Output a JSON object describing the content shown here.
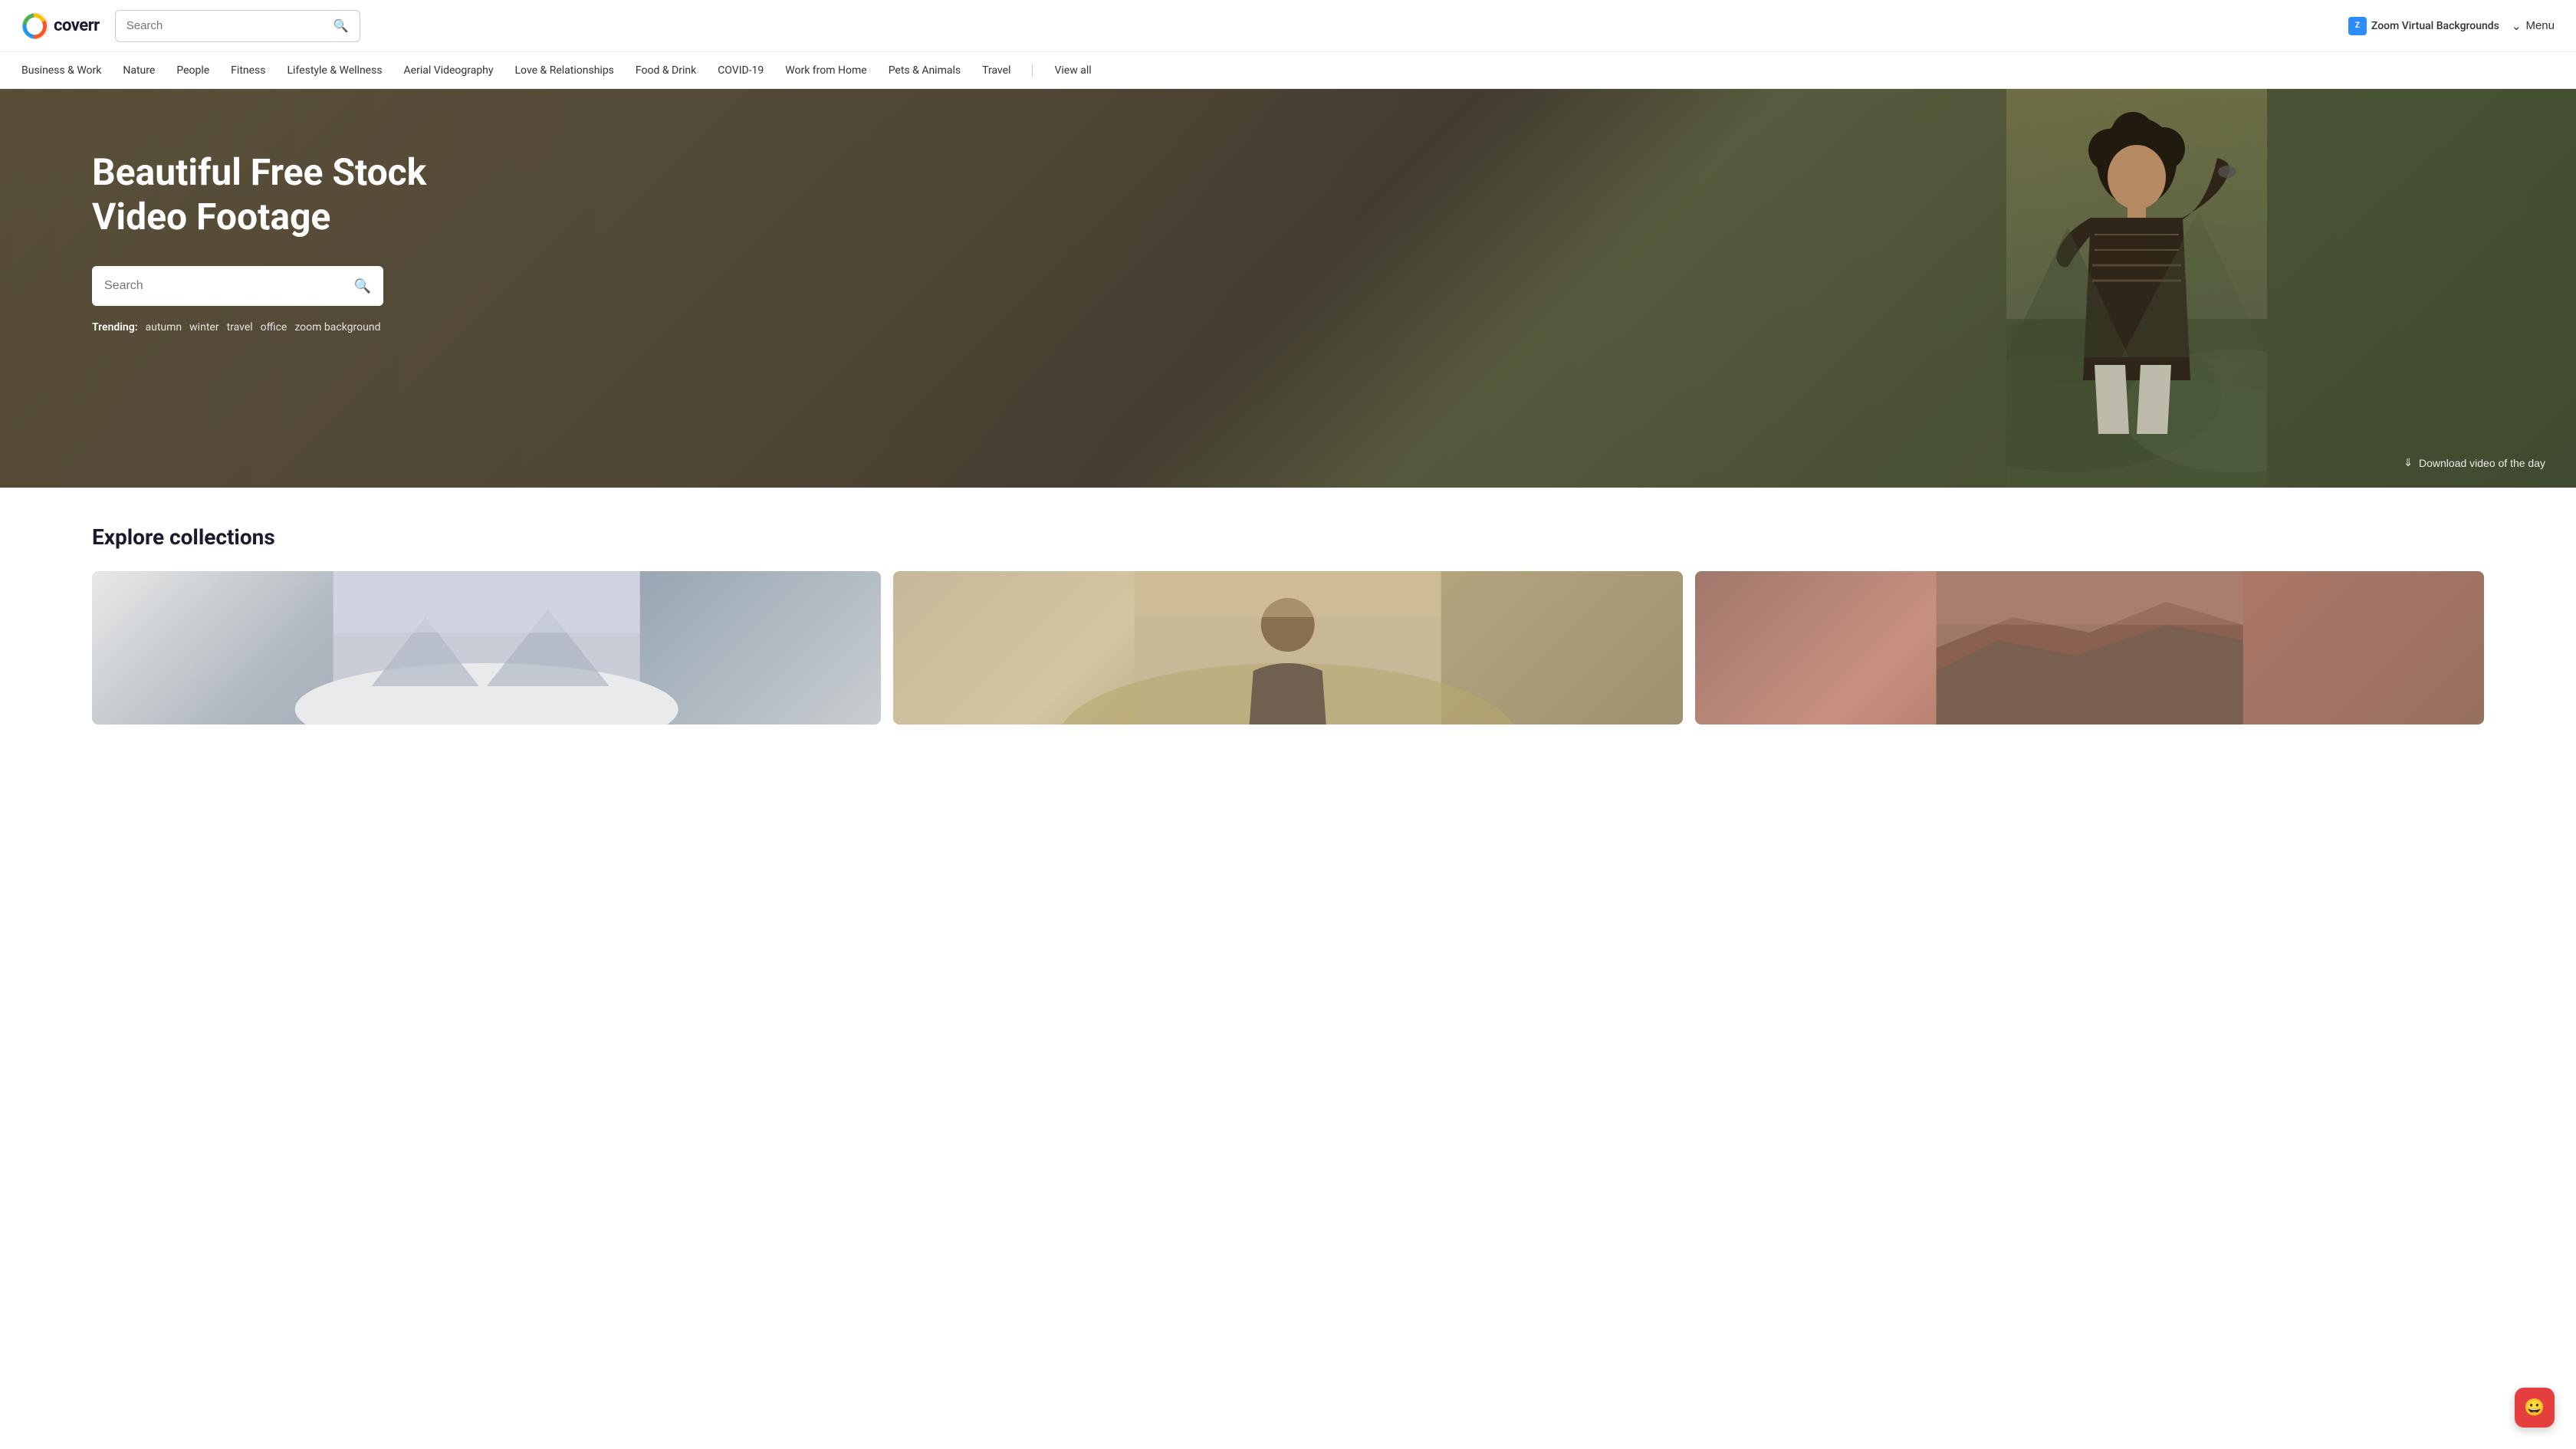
{
  "header": {
    "logo_text": "coverr",
    "search_placeholder": "Search",
    "zoom_label": "Zoom Virtual Backgrounds",
    "menu_label": "Menu"
  },
  "nav": {
    "items": [
      {
        "label": "Business & Work",
        "href": "#"
      },
      {
        "label": "Nature",
        "href": "#"
      },
      {
        "label": "People",
        "href": "#"
      },
      {
        "label": "Fitness",
        "href": "#"
      },
      {
        "label": "Lifestyle & Wellness",
        "href": "#"
      },
      {
        "label": "Aerial Videography",
        "href": "#"
      },
      {
        "label": "Love & Relationships",
        "href": "#"
      },
      {
        "label": "Food & Drink",
        "href": "#"
      },
      {
        "label": "COVID-19",
        "href": "#"
      },
      {
        "label": "Work from Home",
        "href": "#"
      },
      {
        "label": "Pets & Animals",
        "href": "#"
      },
      {
        "label": "Travel",
        "href": "#"
      },
      {
        "label": "View all",
        "href": "#"
      }
    ]
  },
  "hero": {
    "title_line1": "Beautiful Free Stock",
    "title_line2": "Video Footage",
    "search_placeholder": "Search",
    "trending_label": "Trending:",
    "trending_items": [
      "autumn",
      "winter",
      "travel",
      "office",
      "zoom background"
    ],
    "download_label": "Download video of the day"
  },
  "collections": {
    "title": "Explore collections"
  },
  "chat": {
    "icon": "😊"
  }
}
